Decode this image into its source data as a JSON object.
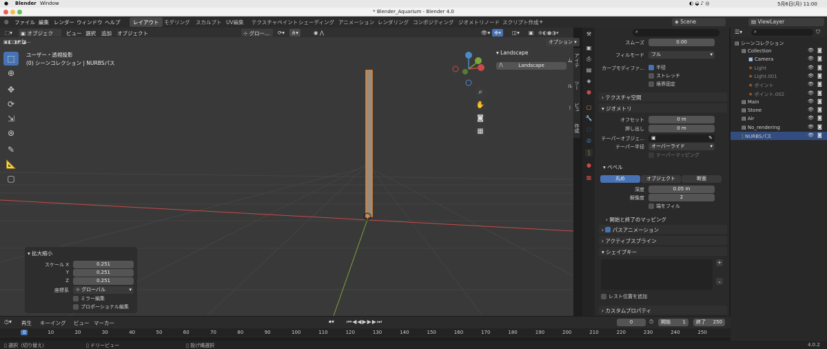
{
  "macbar": {
    "app": "Blender",
    "menu": "Window",
    "clock": "5月6日(月) 11:00"
  },
  "window": {
    "title": "* Blender_Aquarium - Blender 4.0"
  },
  "menus": [
    "ファイル",
    "編集",
    "レンダー",
    "ウィンドウ",
    "ヘルプ"
  ],
  "workspaces": [
    "レイアウト",
    "モデリング",
    "スカルプト",
    "UV編集",
    "テクスチャペイント",
    "シェーディング",
    "アニメーション",
    "レンダリング",
    "コンポジティング",
    "ジオメトリノード",
    "スクリプト作成"
  ],
  "scene": {
    "label": "Scene",
    "viewlayer": "ViewLayer"
  },
  "viewport": {
    "mode": "オブジェクト...",
    "menus": [
      "ビュー",
      "選択",
      "追加",
      "オブジェクト"
    ],
    "transform": "グロー...",
    "info_line1": "ユーザー・透視投影",
    "info_line2": "(0) シーンコレクション | NURBSパス",
    "options": "オプション",
    "npanel_title": "Landscape",
    "npanel_field": "Landscape",
    "side_tabs": [
      "アイテム",
      "ツール",
      "ビュー",
      "作成"
    ]
  },
  "redo_panel": {
    "title": "拡大縮小",
    "scale_x_label": "スケール X",
    "scale_x": "0.251",
    "scale_y_label": "Y",
    "scale_y": "0.251",
    "scale_z_label": "Z",
    "scale_z": "0.251",
    "orient_label": "座標系",
    "orient": "グローバル",
    "mirror": "ミラー編集",
    "proportional": "プロポーショナル編集"
  },
  "timeline": {
    "menus": [
      "再生",
      "キーイング",
      "ビュー",
      "マーカー"
    ],
    "current": "0",
    "start_label": "開始",
    "start": "1",
    "end_label": "終了",
    "end": "250",
    "ticks": [
      "0",
      "10",
      "20",
      "30",
      "40",
      "50",
      "60",
      "70",
      "80",
      "90",
      "100",
      "110",
      "120",
      "130",
      "140",
      "150",
      "160",
      "170",
      "180",
      "190",
      "200",
      "210",
      "220",
      "230",
      "240",
      "250"
    ]
  },
  "status": {
    "select": "選択（切り替え）",
    "dolly": "ドリービュー",
    "lasso": "投げ縄選択",
    "version": "4.0.2"
  },
  "properties": {
    "smooth_label": "スムーズ",
    "smooth": "0.00",
    "fill_label": "フィルモード",
    "fill": "フル",
    "curve_def_label": "カーブモディファ...",
    "radius": "半径",
    "stretch": "ストレッチ",
    "bounds": "境界固定",
    "tex_space": "テクスチャ空間",
    "geometry": "ジオメトリ",
    "offset_label": "オフセット",
    "offset": "0 m",
    "extrude_label": "押し出し",
    "extrude": "0 m",
    "taper_obj_label": "テーパーオブジェ...",
    "taper_radius_label": "テーパー半径",
    "taper_radius": "オーバーライド",
    "taper_mapping": "テーパーマッピング",
    "bevel": "ベベル",
    "bevel_modes": [
      "丸め",
      "オブジェクト",
      "断面"
    ],
    "depth_label": "深度",
    "depth": "0.05 m",
    "resolution_label": "解像度",
    "resolution": "2",
    "fill_caps": "端をフィル",
    "start_end": "開始と終了のマッピング",
    "path_anim": "パスアニメーション",
    "active_spline": "アクティブスプライン",
    "shape_keys": "シェイプキー",
    "rest_pos": "レスト位置を追加",
    "custom_props": "カスタムプロパティ"
  },
  "outliner": {
    "root": "シーンコレクション",
    "items": [
      {
        "name": "Collection",
        "depth": 1
      },
      {
        "name": "Camera",
        "depth": 2
      },
      {
        "name": "Light",
        "depth": 2
      },
      {
        "name": "Light.001",
        "depth": 2
      },
      {
        "name": "ポイント",
        "depth": 2
      },
      {
        "name": "ポイント.002",
        "depth": 2
      },
      {
        "name": "Main",
        "depth": 1
      },
      {
        "name": "Stone",
        "depth": 1
      },
      {
        "name": "Air",
        "depth": 1
      },
      {
        "name": "No_rendering",
        "depth": 1
      },
      {
        "name": "NURBSパス",
        "depth": 1
      }
    ]
  },
  "colors": {
    "accent": "#4772b3",
    "bg": "#393939",
    "x_axis": "#c84a4a",
    "y_axis": "#7da43a",
    "object": "#e08a3c"
  }
}
